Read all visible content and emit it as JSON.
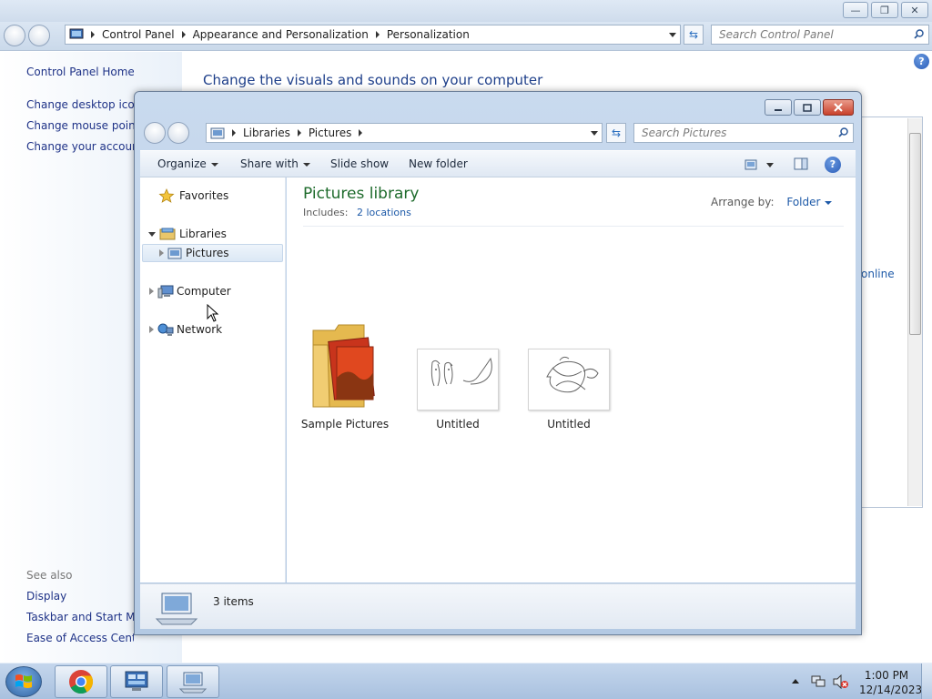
{
  "control_panel": {
    "address": [
      "Control Panel",
      "Appearance and Personalization",
      "Personalization"
    ],
    "search_placeholder": "Search Control Panel",
    "heading": "Change the visuals and sounds on your computer",
    "left_links": [
      "Control Panel Home",
      "Change desktop icons",
      "Change mouse pointers",
      "Change your account picture"
    ],
    "see_also_label": "See also",
    "see_also_links": [
      "Display",
      "Taskbar and Start Menu",
      "Ease of Access Center"
    ],
    "online_link": "online"
  },
  "explorer": {
    "address": [
      "Libraries",
      "Pictures"
    ],
    "search_placeholder": "Search Pictures",
    "toolbar": {
      "organize": "Organize",
      "share_with": "Share with",
      "slide_show": "Slide show",
      "new_folder": "New folder"
    },
    "nav": {
      "favorites": "Favorites",
      "libraries": "Libraries",
      "pictures": "Pictures",
      "computer": "Computer",
      "network": "Network"
    },
    "library": {
      "title": "Pictures library",
      "includes_label": "Includes:",
      "locations_link": "2 locations",
      "arrange_label": "Arrange by:",
      "arrange_value": "Folder"
    },
    "items": [
      {
        "label": "Sample Pictures",
        "type": "folder"
      },
      {
        "label": "Untitled",
        "type": "image"
      },
      {
        "label": "Untitled",
        "type": "image"
      }
    ],
    "status": {
      "count": "3 items"
    }
  },
  "taskbar": {
    "time": "1:00 PM",
    "date": "12/14/2023"
  }
}
